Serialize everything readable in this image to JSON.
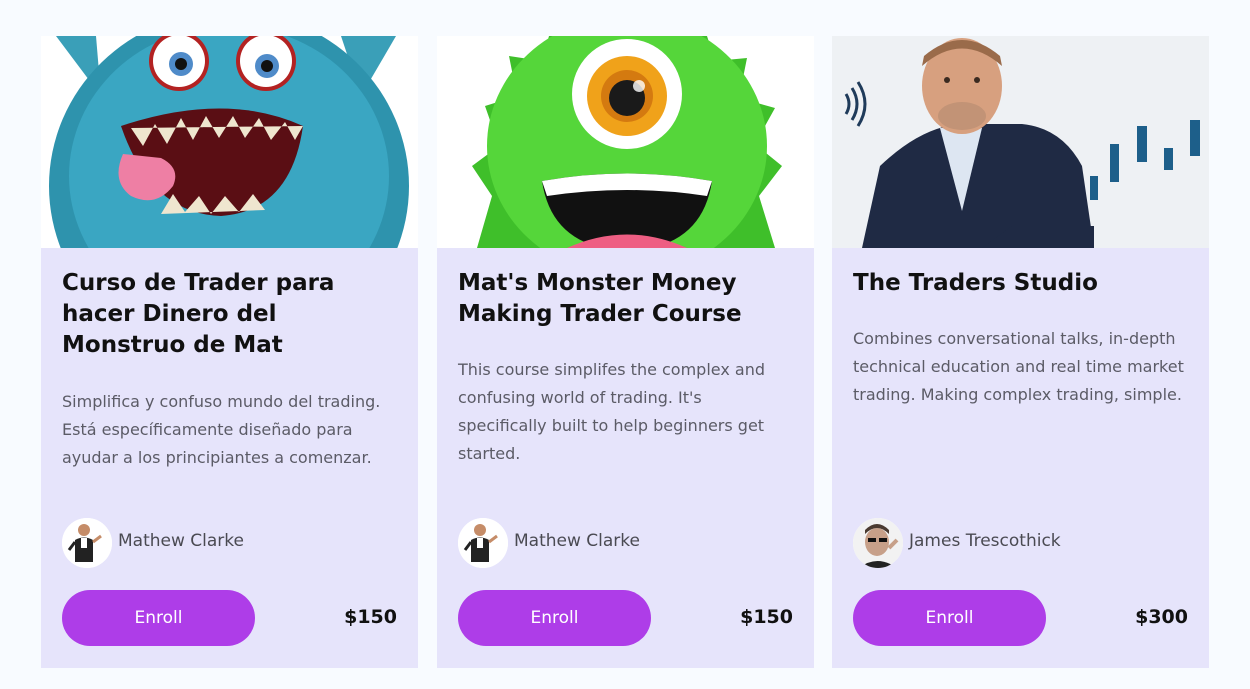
{
  "cards": [
    {
      "title": "Curso de Trader para hacer Dinero del Monstruo de Mat",
      "description": "Simplifica y confuso mundo del trading. Está específicamente diseñado para ayudar a los principiantes a comenzar.",
      "author": "Mathew Clarke",
      "button_label": "Enroll",
      "price": "$150",
      "image": "blue-furry-monster"
    },
    {
      "title": "Mat's Monster Money Making Trader Course",
      "description": "This course simplifes the complex and confusing world of trading. It's specifically built to help beginners get started.",
      "author": "Mathew Clarke",
      "button_label": "Enroll",
      "price": "$150",
      "image": "green-one-eyed-monster"
    },
    {
      "title": "The Traders Studio",
      "description": "Combines conversational talks, in-depth technical education and real time market trading. Making complex trading, simple.",
      "author": "James Trescothick",
      "button_label": "Enroll",
      "price": "$300",
      "image": "presenter-with-bar-chart"
    }
  ],
  "colors": {
    "page_bg": "#f8fbff",
    "card_bg": "#e6e4fb",
    "button": "#ae3de8",
    "button_text": "#ffffff",
    "title_text": "#111111",
    "body_text": "#5b5b66"
  }
}
